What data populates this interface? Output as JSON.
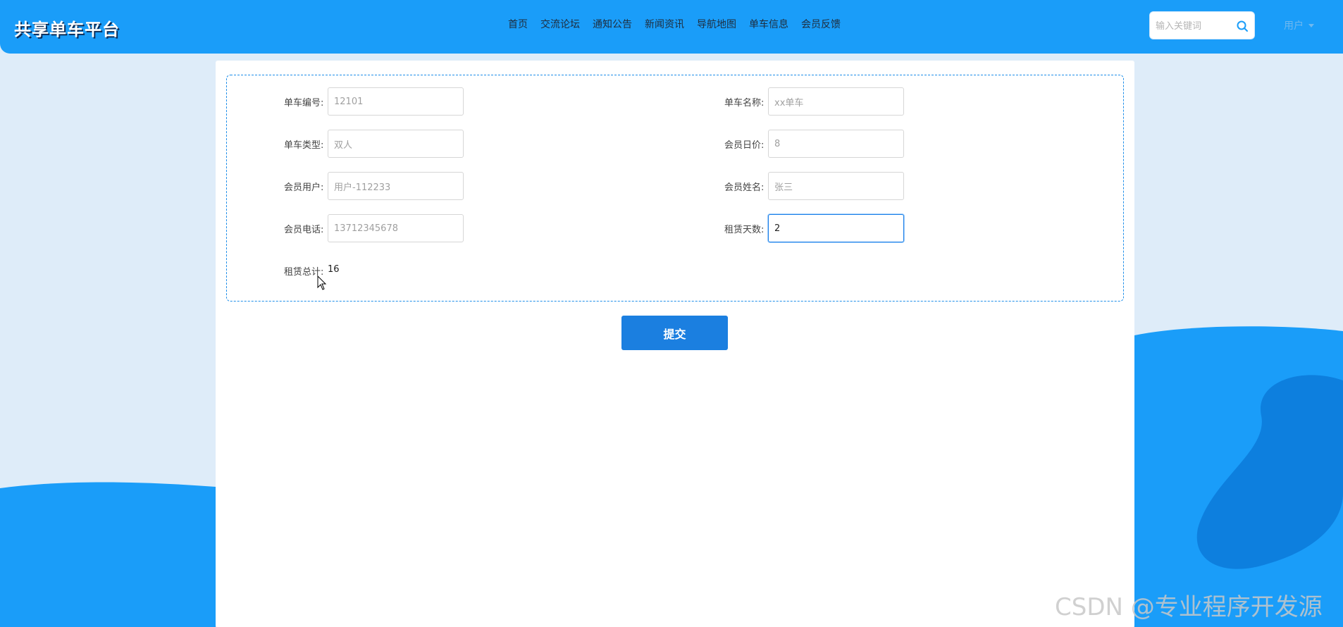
{
  "header": {
    "brand": "共享单车平台",
    "nav": [
      "首页",
      "交流论坛",
      "通知公告",
      "新闻资讯",
      "导航地图",
      "单车信息",
      "会员反馈"
    ],
    "search_placeholder": "输入关键词",
    "search_icon": "search-icon",
    "user_label": "用户"
  },
  "form": {
    "bike_no": {
      "label": "单车编号:",
      "value": "12101"
    },
    "bike_name": {
      "label": "单车名称:",
      "value": "xx单车"
    },
    "bike_type": {
      "label": "单车类型:",
      "value": "双人"
    },
    "member_day_price": {
      "label": "会员日价:",
      "value": "8"
    },
    "member_user": {
      "label": "会员用户:",
      "value": "用户-112233"
    },
    "member_name": {
      "label": "会员姓名:",
      "value": "张三"
    },
    "member_phone": {
      "label": "会员电话:",
      "value": "13712345678"
    },
    "rent_days": {
      "label": "租赁天数:",
      "value": "2"
    },
    "rent_total": {
      "label": "租赁总计:",
      "value": "16"
    },
    "submit_label": "提交"
  },
  "watermark": "CSDN @专业程序开发源",
  "colors": {
    "header_bg": "#1a9df9",
    "page_bg": "#deecf9",
    "wave": "#1a9df9",
    "wave_dark": "#0d7fde",
    "button": "#1b7fe0",
    "form_border": "#1e8ee9"
  }
}
